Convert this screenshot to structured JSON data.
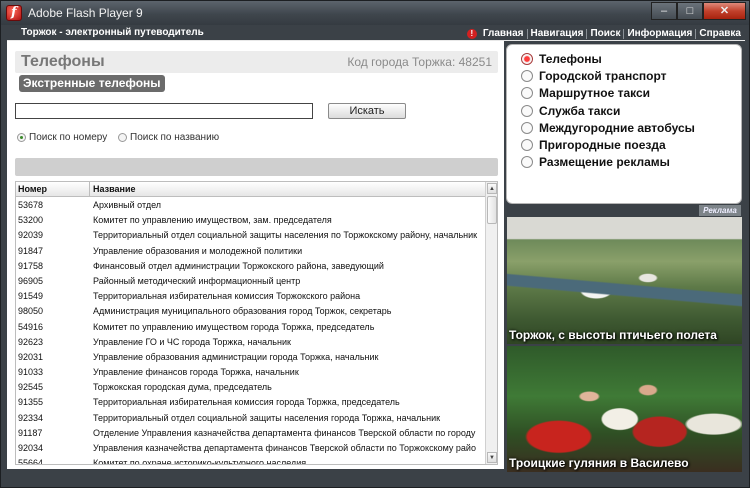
{
  "window": {
    "title": "Adobe Flash Player 9",
    "buttons": {
      "minimize": "–",
      "maximize": "□",
      "close": "✕"
    }
  },
  "header": {
    "title": "Торжок - электронный путеводитель",
    "warn_glyph": "!",
    "nav": [
      "Главная",
      "Навигация",
      "Поиск",
      "Информация",
      "Справка"
    ]
  },
  "main": {
    "title": "Телефоны",
    "city_code": "Код города Торжка: 48251",
    "section": "Экстренные телефоны",
    "search": {
      "value": "",
      "button": "Искать"
    },
    "radios": [
      {
        "label": "Поиск по номеру",
        "selected": true
      },
      {
        "label": "Поиск по названию",
        "selected": false
      }
    ],
    "table": {
      "columns": [
        "Номер",
        "Название"
      ],
      "rows": [
        [
          "53678",
          "Архивный отдел"
        ],
        [
          "53200",
          "Комитет по управлению имуществом, зам. председателя"
        ],
        [
          "92039",
          "Территориальный отдел социальной защиты населения по Торжокскому району, начальник"
        ],
        [
          "91847",
          "Управление образования и молодежной политики"
        ],
        [
          "91758",
          "Финансовый отдел администрации Торжокского района, заведующий"
        ],
        [
          "96905",
          "Районный методический информационный центр"
        ],
        [
          "91549",
          "Территориальная избирательная комиссия Торжокского района"
        ],
        [
          "98050",
          "Администрация муниципального образования город Торжок, секретарь"
        ],
        [
          "54916",
          "Комитет по управлению имуществом города Торжка, председатель"
        ],
        [
          "92623",
          "Управление ГО и ЧС города Торжка, начальник"
        ],
        [
          "92031",
          "Управление образования администрации города Торжка, начальник"
        ],
        [
          "91033",
          "Управление финансов города Торжка, начальник"
        ],
        [
          "92545",
          "Торжокская городская дума, председатель"
        ],
        [
          "91355",
          "Территориальная избирательная комиссия города Торжка, председатель"
        ],
        [
          "92334",
          "Территориальный отдел социальной защиты населения города Торжка, начальник"
        ],
        [
          "91187",
          "Отделение Управления казначейства департамента финансов Тверской области по городу"
        ],
        [
          "92034",
          "Управления казначейства департамента финансов Тверской области по Торжокскому райо"
        ],
        [
          "55664",
          "Комитет по охране историко-культурного наследия"
        ]
      ]
    }
  },
  "menu": {
    "items": [
      {
        "label": "Телефоны",
        "selected": true
      },
      {
        "label": "Городской транспорт",
        "selected": false
      },
      {
        "label": "Маршрутное такси",
        "selected": false
      },
      {
        "label": "Служба такси",
        "selected": false
      },
      {
        "label": "Междугородние автобусы",
        "selected": false
      },
      {
        "label": "Пригородные поезда",
        "selected": false
      },
      {
        "label": "Размещение рекламы",
        "selected": false
      }
    ]
  },
  "ads": {
    "label": "Реклама",
    "photos": [
      {
        "caption": "Торжок, с высоты птичьего полета"
      },
      {
        "caption": "Троицкие гуляния в Василево"
      }
    ]
  }
}
